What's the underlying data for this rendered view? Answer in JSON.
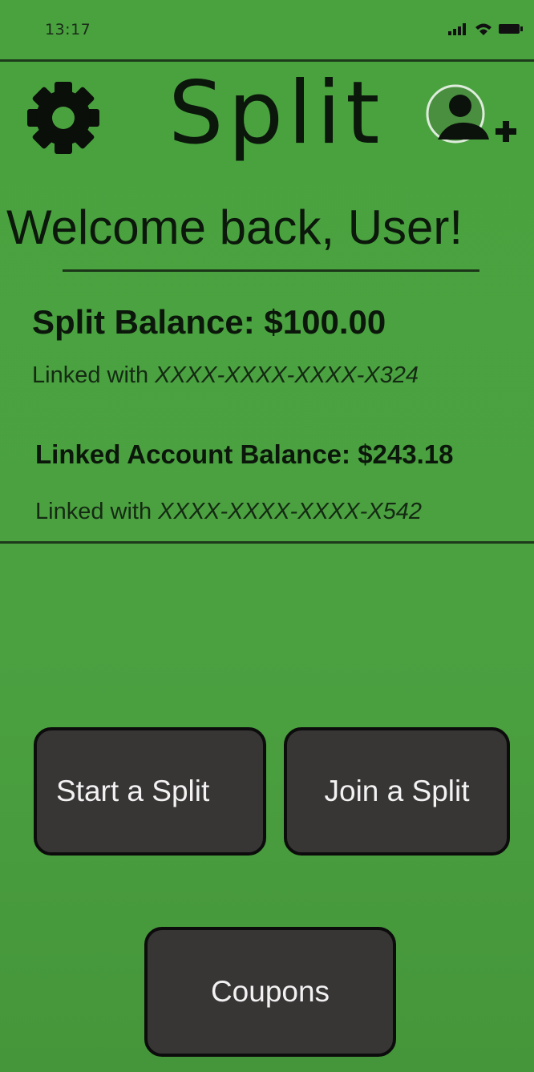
{
  "status_bar": {
    "time": "13:17"
  },
  "header": {
    "title": "Split",
    "settings_icon": "gear-icon",
    "add_user_icon": "add-user-icon"
  },
  "welcome": {
    "text": "Welcome back, User!"
  },
  "split_balance": {
    "label": "Split Balance: $100.00",
    "linked_prefix": "Linked with",
    "linked_account": "XXXX-XXXX-XXXX-X324"
  },
  "linked_account_balance": {
    "label": "Linked Account Balance: $243.18",
    "linked_prefix": "Linked with",
    "linked_account": "XXXX-XXXX-XXXX-X542"
  },
  "actions": {
    "start_split": "Start a Split",
    "join_split": "Join a Split",
    "coupons": "Coupons"
  },
  "colors": {
    "background": "#4aa23f",
    "button_fill": "#383535",
    "button_border": "#0c0c0c",
    "text_dark": "#0b170b"
  }
}
